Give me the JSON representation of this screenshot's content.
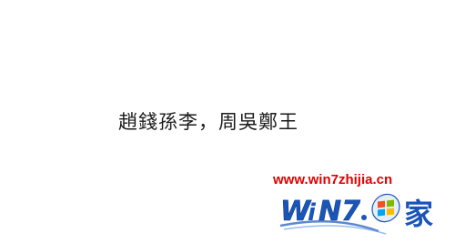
{
  "content": {
    "text": "趙錢孫李，周吳鄭王"
  },
  "watermark": {
    "url": "www.win7zhijia.cn",
    "logo_text": "WiN7.之家",
    "logo_icon": "windows-flag-icon",
    "url_color": "#e00000",
    "logo_color": "#1a56b8"
  }
}
